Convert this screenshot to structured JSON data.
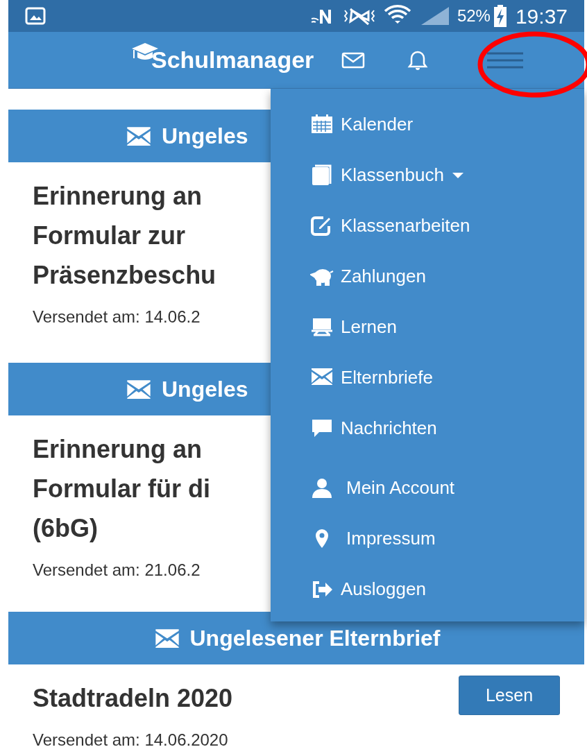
{
  "status_bar": {
    "battery": "52%",
    "time": "19:37"
  },
  "header": {
    "title": "Schulmanager"
  },
  "cards": [
    {
      "header": "Ungeles",
      "title": "Erinnerung an\nFormular zur\nPräsenzbeschu",
      "date": "Versendet am: 14.06.2"
    },
    {
      "header": "Ungeles",
      "title": "Erinnerung an\nFormular für di\n(6bG)",
      "date": "Versendet am: 21.06.2"
    },
    {
      "header": "Ungelesener Elternbrief",
      "title": "Stadtradeln 2020",
      "date": "Versendet am: 14.06.2020",
      "button": "Lesen"
    }
  ],
  "menu": {
    "items": [
      {
        "label": "Kalender",
        "dropdown": false
      },
      {
        "label": "Klassenbuch",
        "dropdown": true
      },
      {
        "label": "Klassenarbeiten",
        "dropdown": false
      },
      {
        "label": "Zahlungen",
        "dropdown": false
      },
      {
        "label": "Lernen",
        "dropdown": false
      },
      {
        "label": "Elternbriefe",
        "dropdown": false
      },
      {
        "label": "Nachrichten",
        "dropdown": false
      },
      {
        "label": "Mein Account",
        "dropdown": false
      },
      {
        "label": "Impressum",
        "dropdown": false
      },
      {
        "label": "Ausloggen",
        "dropdown": false
      }
    ]
  }
}
